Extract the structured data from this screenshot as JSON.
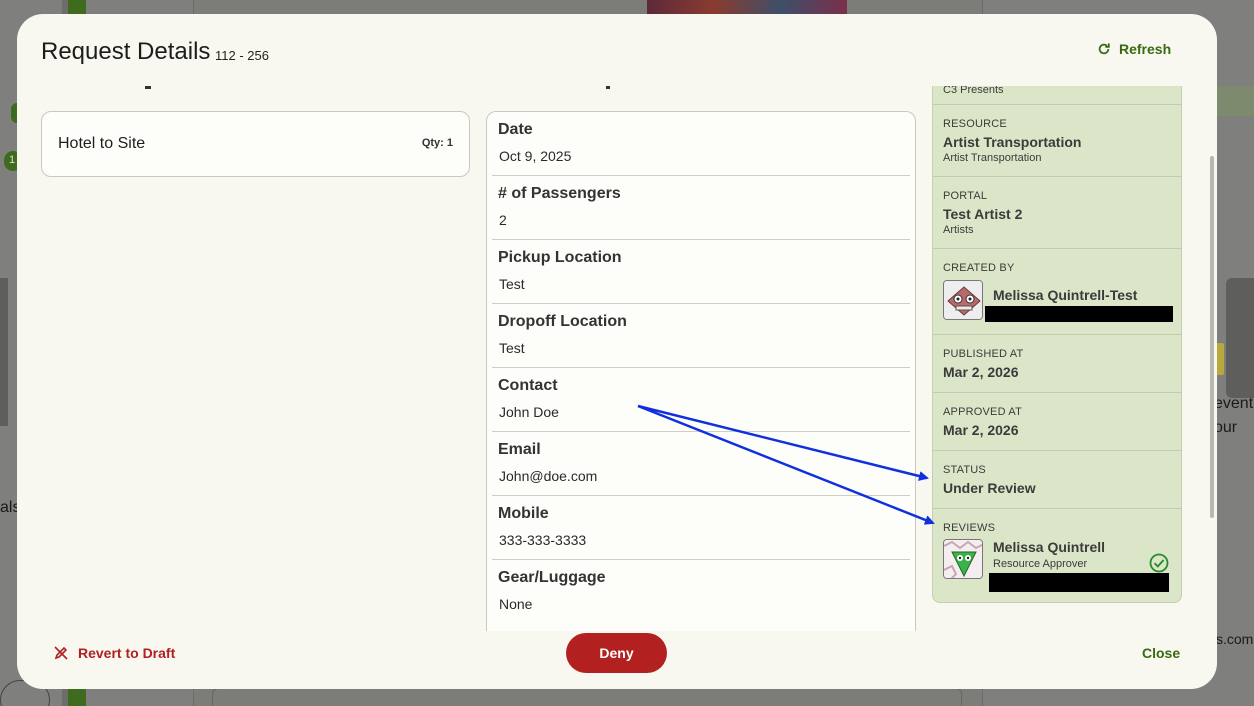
{
  "background": {
    "left_text": "als",
    "right_text_1": "event",
    "right_text_2": "our",
    "right_text_3": "s.com",
    "left_badge": "1"
  },
  "modal": {
    "title": "Request Details",
    "subtitle": "112 - 256",
    "refresh_label": "Refresh"
  },
  "item": {
    "name": "Hotel to Site",
    "qty": "Qty: 1"
  },
  "fields": [
    {
      "label": "Date",
      "value": "Oct 9, 2025"
    },
    {
      "label": "# of Passengers",
      "value": "2"
    },
    {
      "label": "Pickup Location",
      "value": "Test"
    },
    {
      "label": "Dropoff Location",
      "value": "Test"
    },
    {
      "label": "Contact",
      "value": "John Doe"
    },
    {
      "label": "Email",
      "value": "John@doe.com"
    },
    {
      "label": "Mobile",
      "value": "333-333-3333"
    },
    {
      "label": "Gear/Luggage",
      "value": "None"
    }
  ],
  "info": {
    "org_sub": "C3 Presents",
    "resource_cap": "RESOURCE",
    "resource_main": "Artist Transportation",
    "resource_sub": "Artist Transportation",
    "portal_cap": "PORTAL",
    "portal_main": "Test Artist 2",
    "portal_sub": "Artists",
    "created_cap": "CREATED BY",
    "created_name": "Melissa Quintrell-Test",
    "published_cap": "PUBLISHED AT",
    "published_main": "Mar 2, 2026",
    "approved_cap": "APPROVED AT",
    "approved_main": "Mar 2, 2026",
    "status_cap": "STATUS",
    "status_main": "Under Review",
    "reviews_cap": "REVIEWS",
    "reviewer_name": "Melissa Quintrell",
    "reviewer_role": "Resource Approver"
  },
  "footer": {
    "revert_label": "Revert to Draft",
    "deny_label": "Deny",
    "close_label": "Close"
  },
  "colors": {
    "accent_green": "#3a6a10",
    "deny_red": "#b32020",
    "panel_green": "#dbe6c9",
    "annotation_blue": "#1030e0"
  }
}
